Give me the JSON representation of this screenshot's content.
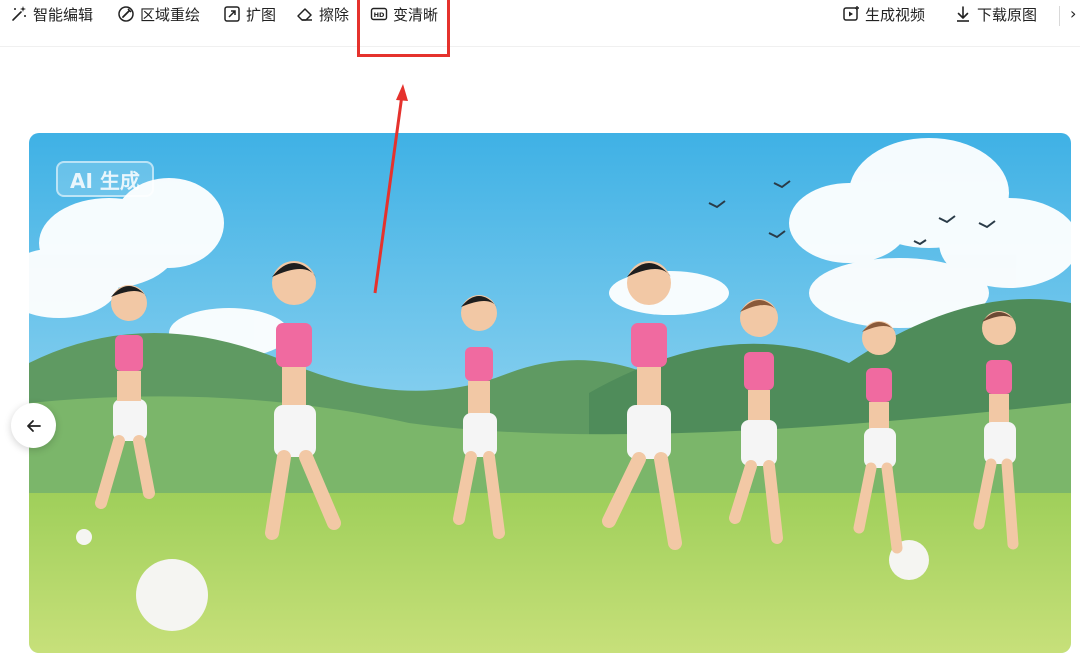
{
  "toolbar": {
    "smart_edit": "智能编辑",
    "region_redraw": "区域重绘",
    "expand": "扩图",
    "erase": "擦除",
    "enhance": "变清晰",
    "generate_video": "生成视频",
    "download_original": "下载原图"
  },
  "image": {
    "badge": "AI 生成",
    "subject": "girls-running-in-meadow"
  },
  "annotation": {
    "highlight_color": "#e5322d"
  }
}
